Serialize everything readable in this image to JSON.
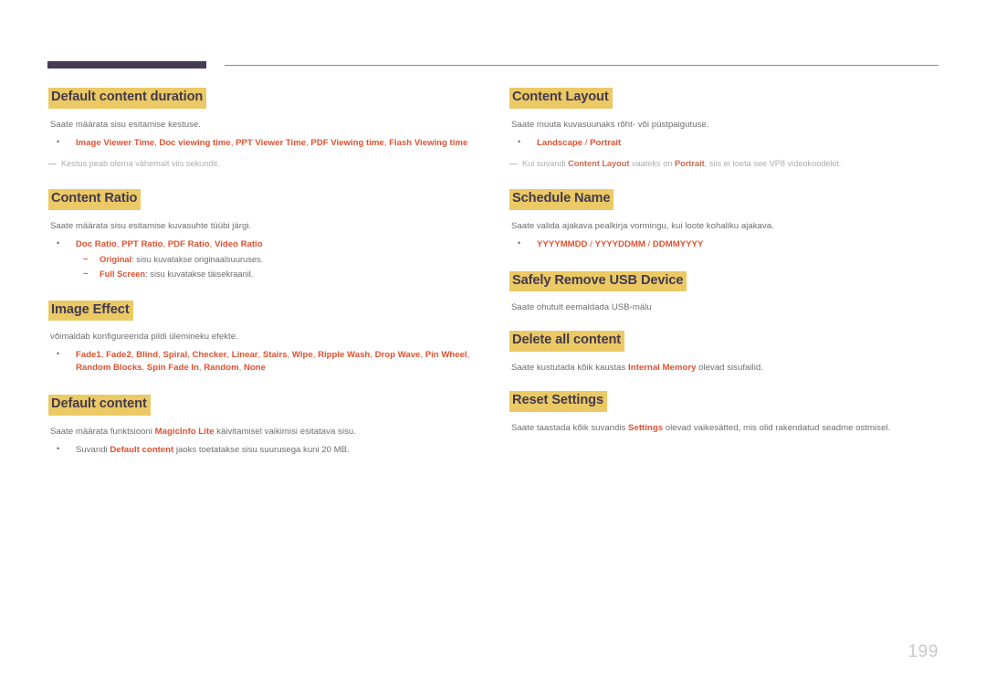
{
  "page": {
    "number": "199",
    "header_bar_color": "#453b52",
    "header_line_color": "#8c8c8c",
    "heading_highlight_color": "#ebc964",
    "heading_text_color": "#433a50",
    "option_color": "#e0512f",
    "body_text_color": "#6e6e6e",
    "note_text_color": "#adadad"
  },
  "left_column": {
    "sections": [
      {
        "heading": "Default content duration",
        "body": "Saate määrata sisu esitamise kestuse.",
        "bullets": [
          {
            "options": [
              "Image Viewer Time",
              "Doc viewing time",
              "PPT Viewer Time",
              "PDF Viewing time",
              "Flash Viewing time"
            ]
          }
        ],
        "note": "Kestus peab olema vähemalt viis sekundit."
      },
      {
        "heading": "Content Ratio",
        "body": "Saate määrata sisu esitamise kuvasuhte tüübi järgi.",
        "bullets": [
          {
            "options": [
              "Doc Ratio",
              "PPT Ratio",
              "PDF Ratio",
              "Video Ratio"
            ],
            "sub": [
              {
                "term": "Original",
                "text": ": sisu kuvatakse originaalsuuruses."
              },
              {
                "term": "Full Screen",
                "text": ": sisu kuvatakse täisekraanil."
              }
            ]
          }
        ]
      },
      {
        "heading": "Image Effect",
        "body": "võimaldab konfigureerida pildi ülemineku efekte.",
        "bullets": [
          {
            "options": [
              "Fade1",
              "Fade2",
              "Blind",
              "Spiral",
              "Checker",
              "Linear",
              "Stairs",
              "Wipe",
              "Ripple Wash",
              "Drop Wave",
              "Pin Wheel",
              "Random Blocks",
              "Spin Fade In",
              "Random",
              "None"
            ]
          }
        ]
      },
      {
        "heading": "Default content",
        "body_pre": "Saate määrata funktsiooni ",
        "body_kw": "MagicInfo Lite",
        "body_post": " käivitamisel vaikimisi esitatava sisu.",
        "plain_bullet": {
          "pre": "Suvandi ",
          "kw": "Default content",
          "post": " jaoks toetatakse sisu suurusega kuni 20 MB."
        }
      }
    ]
  },
  "right_column": {
    "sections": [
      {
        "heading": "Content Layout",
        "body": "Saate muuta kuvasuunaks rõht- või püstpaigutuse.",
        "bullets": [
          {
            "options": [
              "Landscape",
              "Portrait"
            ],
            "separator": " / "
          }
        ],
        "note_parts": {
          "pre": "Kui suvandi ",
          "term1": "Content Layout",
          "mid": " vaateks on ",
          "term2": "Portrait",
          "post": ", siis ei toeta see VP8 videokoodekit."
        }
      },
      {
        "heading": "Schedule Name",
        "body": "Saate valida ajakava pealkirja vormingu, kui loote kohaliku ajakava.",
        "bullets": [
          {
            "options": [
              "YYYYMMDD",
              "YYYYDDMM",
              "DDMMYYYY"
            ],
            "separator": " / "
          }
        ]
      },
      {
        "heading": "Safely Remove USB Device",
        "body": "Saate ohutult eemaldada USB-mälu"
      },
      {
        "heading": "Delete all content",
        "body_pre": "Saate kustutada kõik kaustas ",
        "body_kw": "Internal Memory",
        "body_post": " olevad sisufailid."
      },
      {
        "heading": "Reset Settings",
        "body_pre": "Saate taastada kõik suvandis ",
        "body_kw": "Settings",
        "body_post": " olevad vaikesätted, mis olid rakendatud seadme ostmisel."
      }
    ]
  }
}
